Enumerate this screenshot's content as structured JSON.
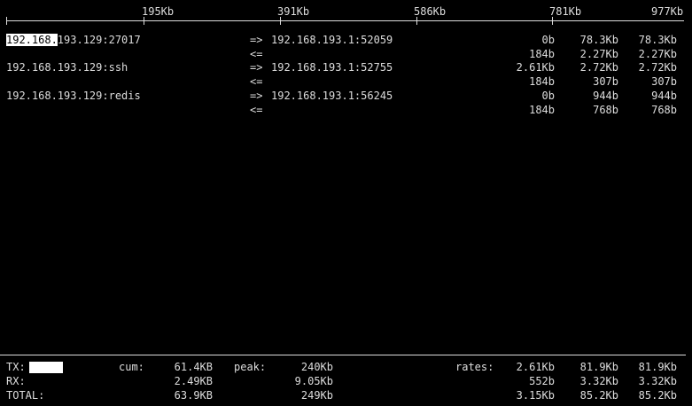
{
  "scale": {
    "ticks": [
      "195Kb",
      "391Kb",
      "586Kb",
      "781Kb",
      "977Kb"
    ]
  },
  "connections": [
    {
      "local_prefix": "192.168.",
      "local_rest": "193.129:27017",
      "tx_arrow": "=>",
      "rx_arrow": "<=",
      "remote": "192.168.193.1:52059",
      "tx": [
        "0b",
        "78.3Kb",
        "78.3Kb"
      ],
      "rx": [
        "184b",
        "2.27Kb",
        "2.27Kb"
      ]
    },
    {
      "local": "192.168.193.129:ssh",
      "tx_arrow": "=>",
      "rx_arrow": "<=",
      "remote": "192.168.193.1:52755",
      "tx": [
        "2.61Kb",
        "2.72Kb",
        "2.72Kb"
      ],
      "rx": [
        "184b",
        "307b",
        "307b"
      ]
    },
    {
      "local": "192.168.193.129:redis",
      "tx_arrow": "=>",
      "rx_arrow": "<=",
      "remote": "192.168.193.1:56245",
      "tx": [
        "0b",
        "944b",
        "944b"
      ],
      "rx": [
        "184b",
        "768b",
        "768b"
      ]
    }
  ],
  "totals": {
    "cum_label": "cum:",
    "peak_label": "peak:",
    "rates_label": "rates:",
    "rows": [
      {
        "label": "TX:",
        "cum": "61.4KB",
        "peak": "240Kb",
        "rates": [
          "2.61Kb",
          "81.9Kb",
          "81.9Kb"
        ]
      },
      {
        "label": "RX:",
        "cum": "2.49KB",
        "peak": "9.05Kb",
        "rates": [
          "552b",
          "3.32Kb",
          "3.32Kb"
        ]
      },
      {
        "label": "TOTAL:",
        "cum": "63.9KB",
        "peak": "249Kb",
        "rates": [
          "3.15Kb",
          "85.2Kb",
          "85.2Kb"
        ]
      }
    ]
  }
}
